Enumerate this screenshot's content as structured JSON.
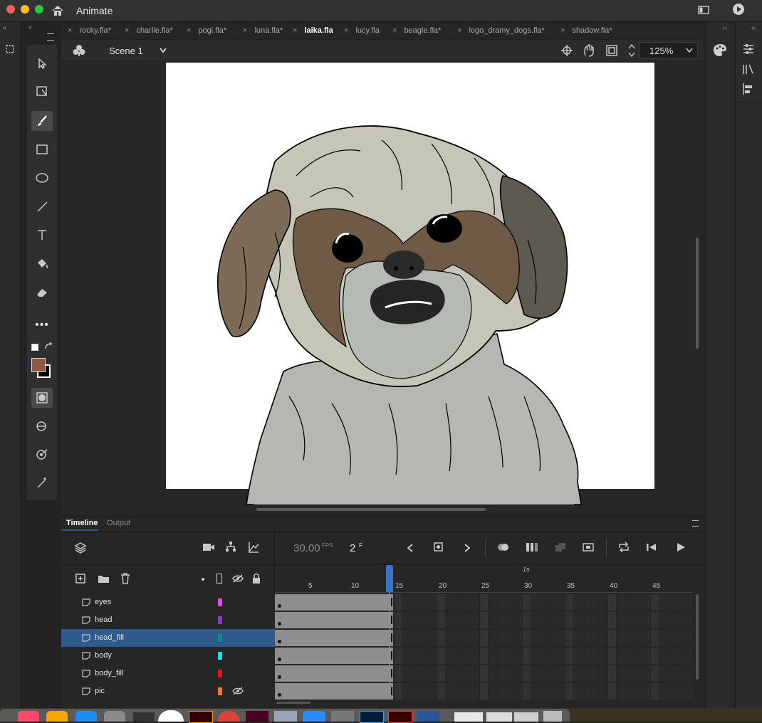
{
  "app": {
    "name": "Animate"
  },
  "tabs": [
    {
      "label": "rocky.fla*"
    },
    {
      "label": "charlie.fla*"
    },
    {
      "label": "pogi.fla*"
    },
    {
      "label": "luna.fla*"
    },
    {
      "label": "laika.fla",
      "active": true
    },
    {
      "label": "lucy.fla"
    },
    {
      "label": "beagle.fla*"
    },
    {
      "label": "logo_dramy_dogs.fla*"
    },
    {
      "label": "shadow.fla*"
    }
  ],
  "scene": {
    "name": "Scene 1",
    "zoom": "125%"
  },
  "colors": {
    "fill": "#8f5a3c",
    "stroke": "#000000",
    "selected_layer": "#2e5a8e",
    "playhead": "#3b74c4"
  },
  "timeline": {
    "tabs": [
      {
        "label": "Timeline"
      },
      {
        "label": "Output"
      }
    ],
    "fps": "30.00",
    "fps_unit": "FPS",
    "frame": "2",
    "frame_unit": "F",
    "ruler_marker": "1s",
    "ticks": [
      "5",
      "10",
      "15",
      "20",
      "25",
      "30",
      "35",
      "40",
      "45"
    ],
    "layers": [
      {
        "name": "eyes",
        "color": "#ff3ee8"
      },
      {
        "name": "head",
        "color": "#8e38c8"
      },
      {
        "name": "head_fill",
        "color": "#0f8a8a",
        "selected": true
      },
      {
        "name": "body",
        "color": "#11e4e4"
      },
      {
        "name": "body_fill",
        "color": "#f01010"
      },
      {
        "name": "pic",
        "color": "#ff7a1a",
        "hidden": true
      }
    ]
  },
  "icons": [
    "home-icon",
    "play-icon",
    "selection-tool-icon",
    "free-transform-icon",
    "brush-tool-icon",
    "rectangle-tool-icon",
    "oval-tool-icon",
    "line-tool-icon",
    "text-tool-icon",
    "paint-bucket-icon",
    "eraser-icon",
    "more-tools-icon",
    "camera-icon",
    "layer-parenting-icon",
    "graph-icon",
    "new-layer-icon",
    "new-folder-icon",
    "trash-icon",
    "eye-icon",
    "lock-icon",
    "loop-icon",
    "properties-icon",
    "library-icon",
    "align-icon"
  ]
}
